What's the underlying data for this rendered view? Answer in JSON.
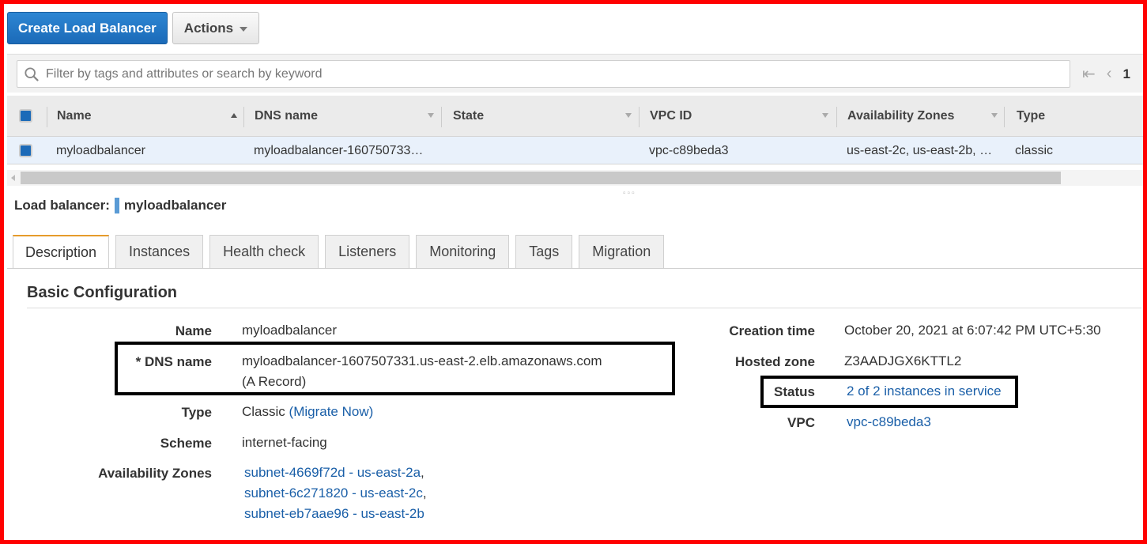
{
  "toolbar": {
    "create_label": "Create Load Balancer",
    "actions_label": "Actions"
  },
  "search": {
    "placeholder": "Filter by tags and attributes or search by keyword",
    "page_number": "1"
  },
  "table": {
    "columns": [
      "Name",
      "DNS name",
      "State",
      "VPC ID",
      "Availability Zones",
      "Type"
    ],
    "row": {
      "name": "myloadbalancer",
      "dns": "myloadbalancer-160750733…",
      "state": "",
      "vpc": "vpc-c89beda3",
      "zones": "us-east-2c, us-east-2b, …",
      "type": "classic"
    }
  },
  "selected": {
    "label": "Load balancer:",
    "name": "myloadbalancer"
  },
  "tabs": [
    "Description",
    "Instances",
    "Health check",
    "Listeners",
    "Monitoring",
    "Tags",
    "Migration"
  ],
  "basic": {
    "title": "Basic Configuration",
    "name_key": "Name",
    "name_val": "myloadbalancer",
    "dns_key": "* DNS name",
    "dns_val": "myloadbalancer-1607507331.us-east-2.elb.amazonaws.com",
    "dns_val2": "(A Record)",
    "type_key": "Type",
    "type_val": "Classic",
    "type_link": "(Migrate Now)",
    "scheme_key": "Scheme",
    "scheme_val": "internet-facing",
    "az_key": "Availability Zones",
    "az": [
      {
        "subnet": "subnet-4669f72d",
        "zone": "us-east-2a",
        "sep": ","
      },
      {
        "subnet": "subnet-6c271820",
        "zone": "us-east-2c",
        "sep": ","
      },
      {
        "subnet": "subnet-eb7aae96",
        "zone": "us-east-2b",
        "sep": ""
      }
    ],
    "creation_key": "Creation time",
    "creation_val": "October 20, 2021 at 6:07:42 PM UTC+5:30",
    "hosted_key": "Hosted zone",
    "hosted_val": "Z3AADJGX6KTTL2",
    "status_key": "Status",
    "status_val": "2 of 2 instances in service",
    "vpc_key": "VPC",
    "vpc_val": "vpc-c89beda3"
  },
  "colors": {
    "primary": "#1b6ab8",
    "link": "#1a5fa8",
    "tab_accent": "#e69b2c",
    "frame": "#ff0000"
  }
}
